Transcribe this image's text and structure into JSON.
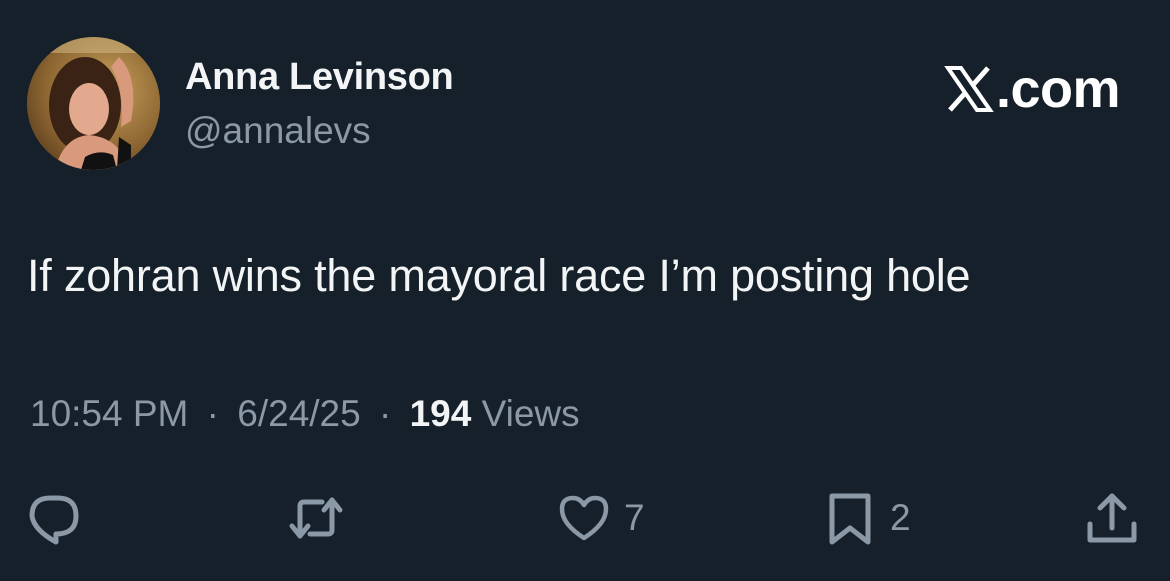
{
  "author": {
    "display_name": "Anna Levinson",
    "handle": "@annalevs"
  },
  "source_label": ".com",
  "source_logo_icon": "x-logo-icon",
  "tweet": {
    "text": "If zohran wins the mayoral race I’m posting hole"
  },
  "meta": {
    "time": "10:54 PM",
    "separator": "·",
    "date": "6/24/25",
    "views_count": "194",
    "views_label": "Views"
  },
  "actions": {
    "reply_icon": "reply-icon",
    "retweet_icon": "retweet-icon",
    "like_icon": "heart-icon",
    "like_count": "7",
    "bookmark_icon": "bookmark-icon",
    "bookmark_count": "2",
    "share_icon": "share-icon"
  },
  "colors": {
    "background": "#15202b",
    "primary_text": "#e7e9ea",
    "secondary_text": "#8b98a5"
  }
}
